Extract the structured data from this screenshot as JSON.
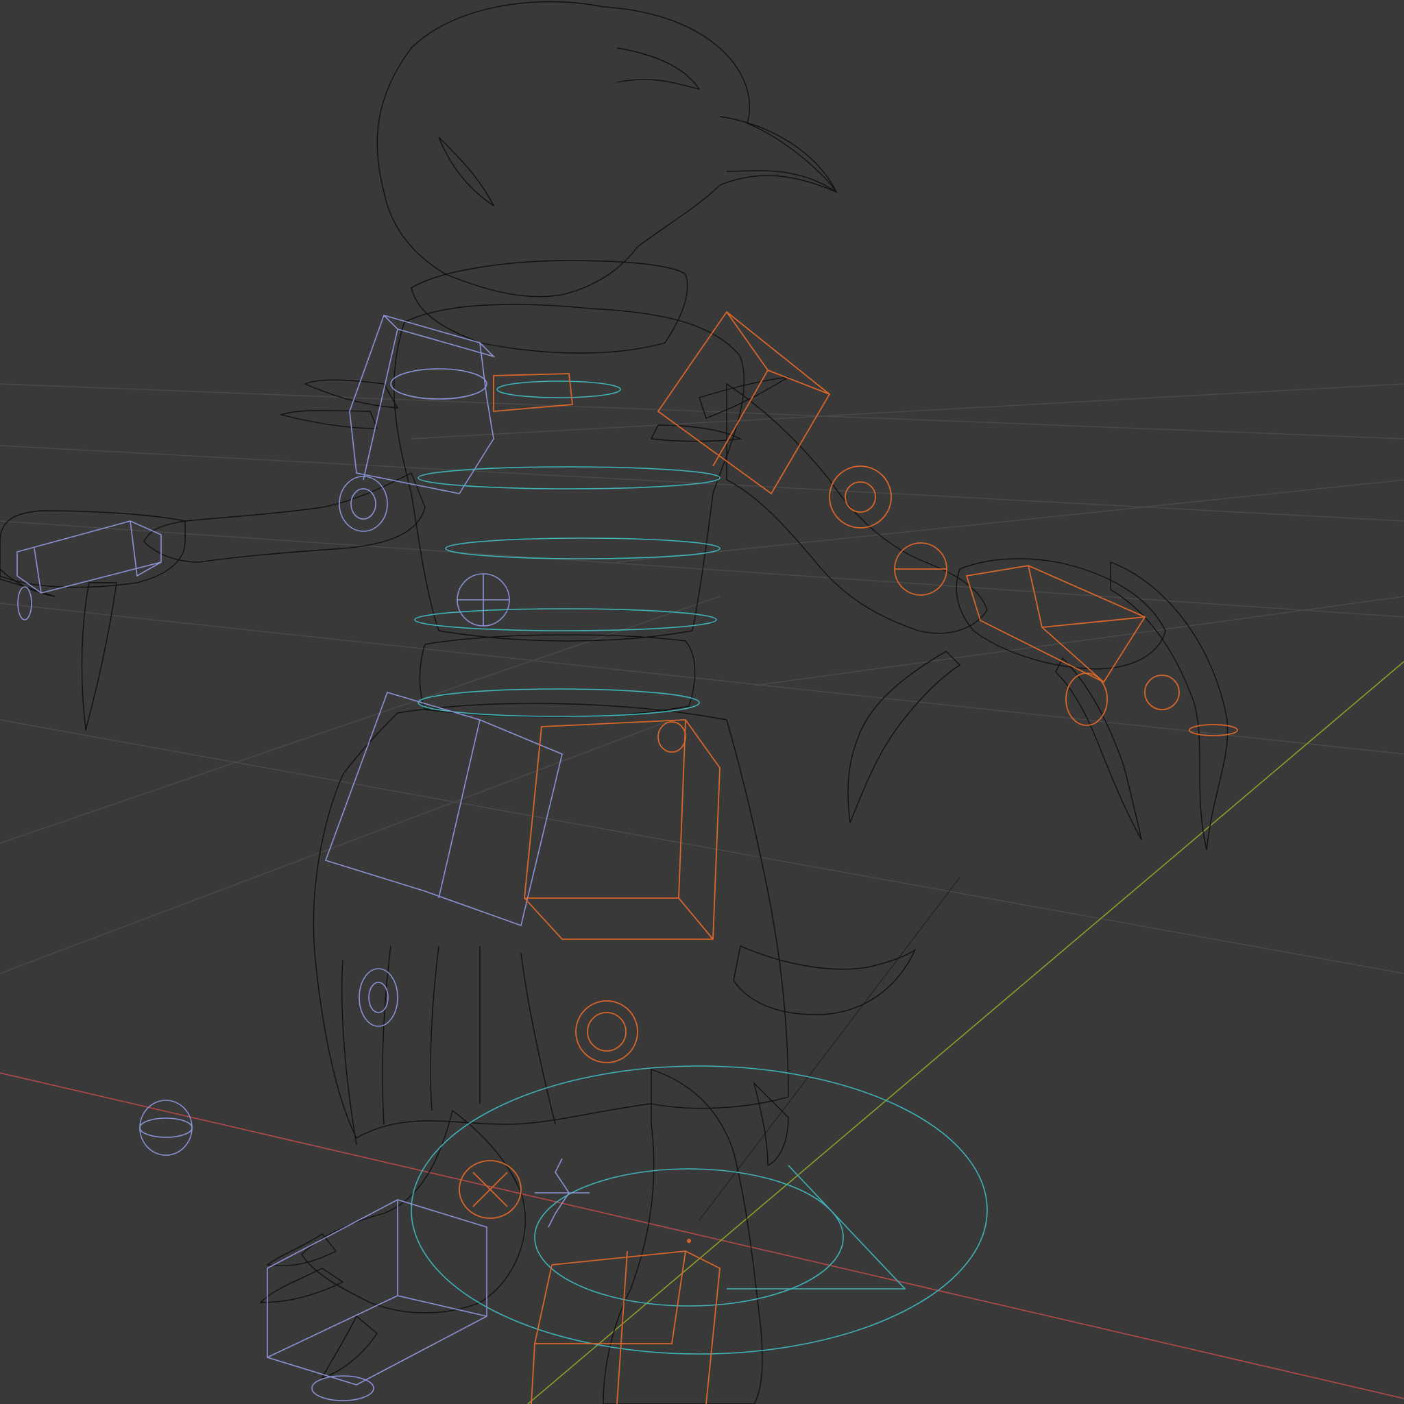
{
  "viewport": {
    "mode": "wireframe",
    "background_color": "#393939",
    "grid_color": "#4a4a4a",
    "x_axis_color": "#b54a4a",
    "y_axis_color": "#8aa12b",
    "mesh_wire_color": "#111111"
  },
  "rig": {
    "left_side_bone_color": "#8b93d6",
    "right_side_bone_color": "#d9662a",
    "center_bone_color": "#3fb3b7"
  },
  "subject": "creature-character-mesh"
}
